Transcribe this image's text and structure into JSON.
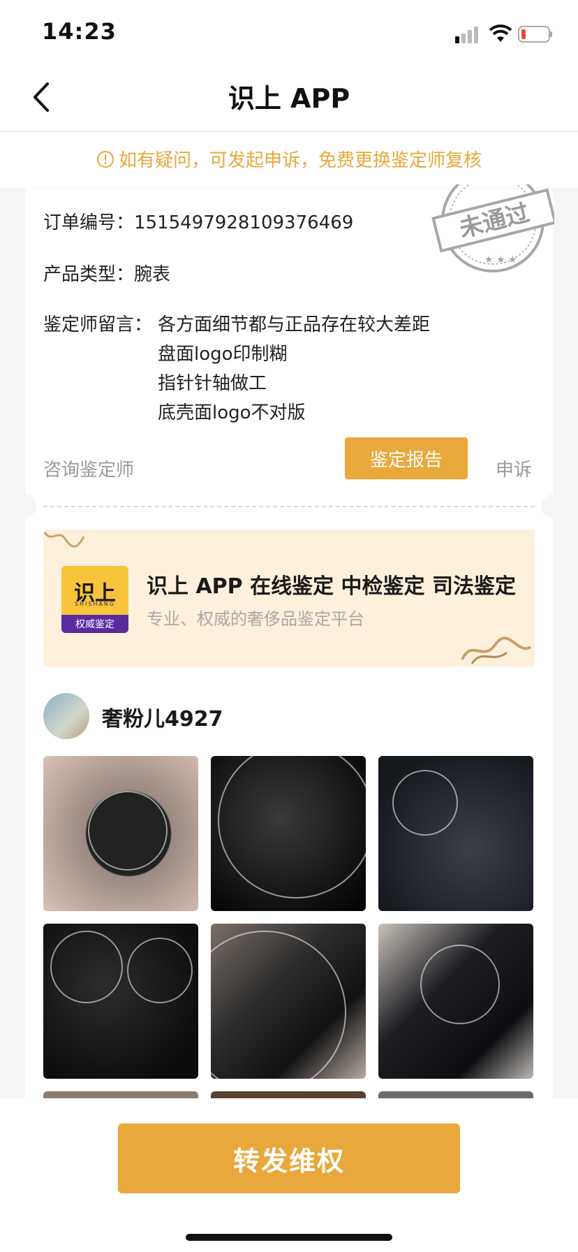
{
  "status_bar": {
    "time": "14:23"
  },
  "nav": {
    "title": "识上 APP"
  },
  "notice": {
    "text": "如有疑问，可发起申诉，免费更换鉴定师复核"
  },
  "order": {
    "number_label": "订单编号：",
    "number": "1515497928109376469",
    "type_label": "产品类型：",
    "type": "腕表",
    "message_label": "鉴定师留言：",
    "message_lines": [
      "各方面细节都与正品存在较大差距",
      "盘面logo印制糊",
      "指针针轴做工",
      "底壳面logo不对版"
    ],
    "stamp_text": "未通过"
  },
  "actions": {
    "consult": "咨询鉴定师",
    "report": "鉴定报告",
    "appeal": "申诉"
  },
  "banner": {
    "logo_main": "识上",
    "logo_pinyin": "SHISHANG",
    "logo_tag": "权威鉴定",
    "title": "识上 APP 在线鉴定 中检鉴定 司法鉴定",
    "subtitle": "专业、权威的奢侈品鉴定平台"
  },
  "user": {
    "name": "奢粉儿4927"
  },
  "bottom": {
    "forward_label": "转发维权"
  },
  "colors": {
    "accent": "#e8a83b",
    "banner_bg": "#fdf0dc",
    "logo_purple": "#5a2ba0"
  }
}
